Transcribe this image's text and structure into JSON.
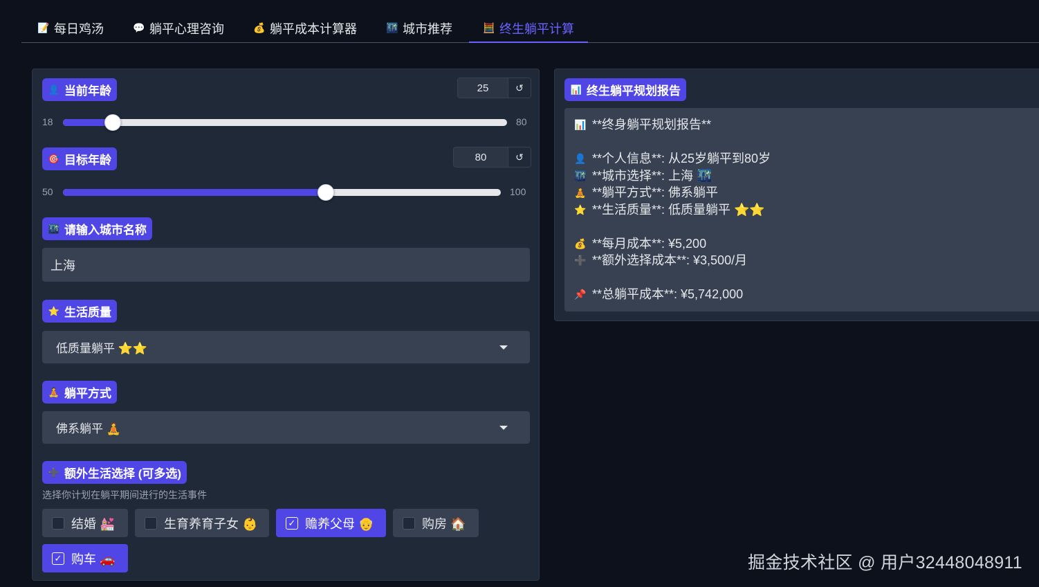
{
  "tabs": [
    {
      "label": "每日鸡汤",
      "icon": "memo-icon",
      "glyph": "📝"
    },
    {
      "label": "躺平心理咨询",
      "icon": "speech-bubble-icon",
      "glyph": "💬"
    },
    {
      "label": "躺平成本计算器",
      "icon": "money-bag-icon",
      "glyph": "💰"
    },
    {
      "label": "城市推荐",
      "icon": "cityscape-icon",
      "glyph": "🌃"
    },
    {
      "label": "终生躺平计算",
      "icon": "abacus-icon",
      "glyph": "🧮",
      "active": true
    }
  ],
  "form": {
    "age": {
      "label": "当前年龄",
      "icon_glyph": "👤",
      "value": "25",
      "min": "18",
      "max": "80",
      "reset_glyph": "↺",
      "fraction": 0.1129
    },
    "target": {
      "label": "目标年龄",
      "icon_glyph": "🎯",
      "value": "80",
      "min": "50",
      "max": "100",
      "reset_glyph": "↺",
      "fraction": 0.6
    },
    "city": {
      "label": "请输入城市名称",
      "icon_glyph": "🌃",
      "value": "上海"
    },
    "quality": {
      "label": "生活质量",
      "icon_glyph": "⭐",
      "value": "低质量躺平 ⭐⭐"
    },
    "mode": {
      "label": "躺平方式",
      "icon_glyph": "🧘",
      "value": "佛系躺平 🧘"
    },
    "extras": {
      "label": "额外生活选择 (可多选)",
      "icon_glyph": "➕",
      "info": "选择你计划在躺平期间进行的生活事件",
      "check_glyph": "✓",
      "options": [
        {
          "label": "结婚 💒",
          "checked": false
        },
        {
          "label": "生育养育子女 👶",
          "checked": false
        },
        {
          "label": "赡养父母 👴",
          "checked": true
        },
        {
          "label": "购房 🏠",
          "checked": false
        },
        {
          "label": "购车 🚗",
          "checked": true
        }
      ]
    }
  },
  "report": {
    "label": "终生躺平规划报告",
    "icon_glyph": "📊",
    "lines": [
      {
        "glyph": "📊",
        "text": "**终身躺平规划报告**"
      },
      {
        "glyph": "",
        "text": ""
      },
      {
        "glyph": "👤",
        "text": "**个人信息**: 从25岁躺平到80岁"
      },
      {
        "glyph": "🌃",
        "text": "**城市选择**: 上海 🌃"
      },
      {
        "glyph": "🧘",
        "text": "**躺平方式**: 佛系躺平"
      },
      {
        "glyph": "⭐",
        "text": "**生活质量**: 低质量躺平 ⭐⭐"
      },
      {
        "glyph": "",
        "text": ""
      },
      {
        "glyph": "💰",
        "text": "**每月成本**: ¥5,200"
      },
      {
        "glyph": "➕",
        "text": "**额外选择成本**: ¥3,500/月"
      },
      {
        "glyph": "",
        "text": ""
      },
      {
        "glyph": "📌",
        "text": "**总躺平成本**: ¥5,742,000"
      }
    ]
  },
  "watermark": "掘金技术社区 @ 用户32448048911",
  "colors": {
    "accent": "#4f46e5",
    "active_tab": "#6b63ff",
    "background": "#0c111c",
    "panel": "#1f2937",
    "input": "#374151"
  }
}
